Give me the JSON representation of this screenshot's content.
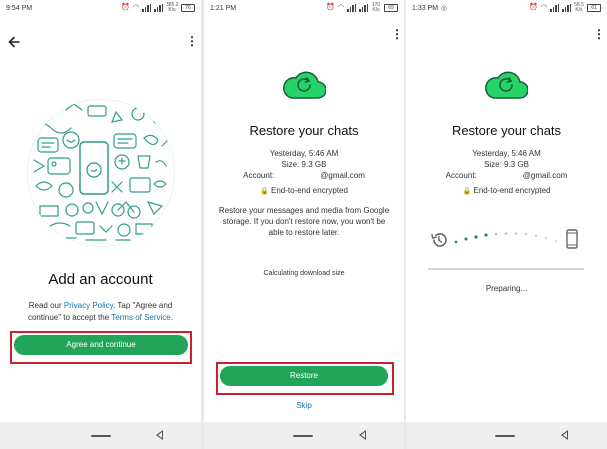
{
  "screens": [
    {
      "status_time": "9:54 PM",
      "status_netspeed": "385.2 K/s",
      "status_battery": "76",
      "title": "Add an account",
      "body_prefix": "Read our ",
      "privacy_link": "Privacy Policy",
      "body_middle": ". Tap \"Agree and continue\" to accept the ",
      "terms_link": "Terms of Service",
      "body_suffix": ".",
      "button_label": "Agree and continue"
    },
    {
      "status_time": "1:21 PM",
      "status_netspeed": "170 K/s",
      "status_battery": "69",
      "title": "Restore your chats",
      "backup_date": "Yesterday, 5:46 AM",
      "backup_size": "Size: 9.3 GB",
      "account_label": "Account:",
      "account_value": "@gmail.com",
      "encryption_label": "End-to-end encrypted",
      "description": "Restore your messages and media from Google storage. If you don't restore now, you won't be able to restore later.",
      "status_message": "Calculating download size",
      "button_label": "Restore",
      "skip_label": "Skip"
    },
    {
      "status_time": "1:33 PM",
      "status_netspeed": "58.5 K/s",
      "status_battery": "61",
      "title": "Restore your chats",
      "backup_date": "Yesterday, 5:46 AM",
      "backup_size": "Size: 9.3 GB",
      "account_label": "Account:",
      "account_value": "@gmail.com",
      "encryption_label": "End-to-end encrypted",
      "progress_message": "Preparing..."
    }
  ],
  "colors": {
    "accent": "#22a45a",
    "cloud": "#25d366",
    "highlight": "#c8232c",
    "link": "#1a73a8",
    "illustration": "#2f9e8a"
  },
  "icons": [
    "back-arrow-icon",
    "more-options-icon",
    "cloud-restore-icon",
    "lock-icon",
    "history-icon",
    "phone-icon",
    "whatsapp-icon",
    "nav-home-icon",
    "nav-back-icon"
  ]
}
